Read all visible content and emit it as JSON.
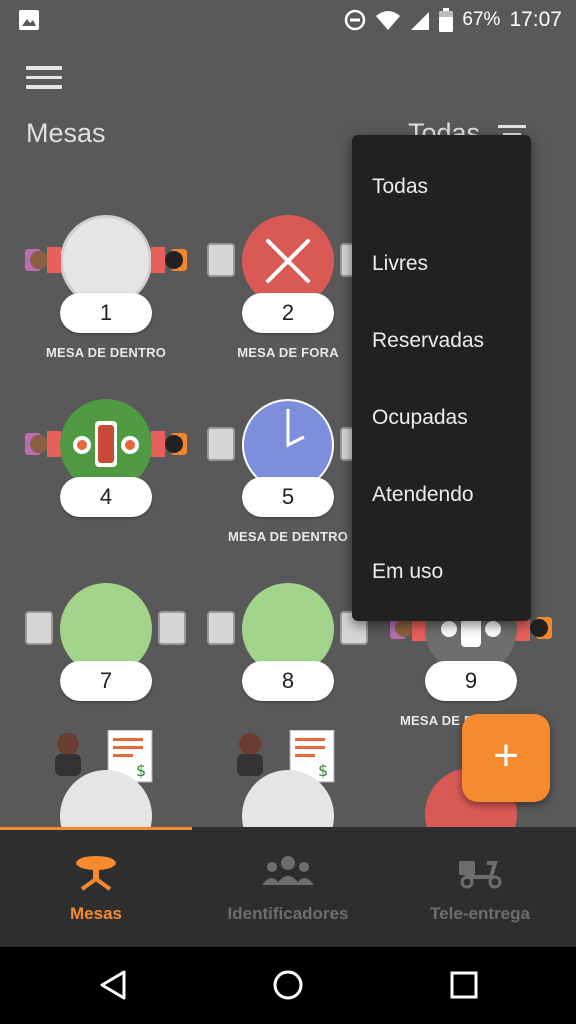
{
  "status_bar": {
    "battery": "67%",
    "time": "17:07"
  },
  "header": {
    "title": "Mesas",
    "filter_label": "Todas"
  },
  "tables": [
    {
      "number": "1",
      "label": "MESA DE DENTRO",
      "state": "occupied"
    },
    {
      "number": "2",
      "label": "MESA DE FORA",
      "state": "reserved"
    },
    {
      "number": "4",
      "label": "",
      "state": "serving"
    },
    {
      "number": "5",
      "label": "MESA DE DENTRO",
      "state": "waiting"
    },
    {
      "number": "7",
      "label": "",
      "state": "free"
    },
    {
      "number": "8",
      "label": "",
      "state": "free"
    },
    {
      "number": "9",
      "label": "MESA DE F",
      "state": "serving"
    }
  ],
  "filter_menu": [
    "Todas",
    "Livres",
    "Reservadas",
    "Ocupadas",
    "Atendendo",
    "Em uso"
  ],
  "fab": {
    "label": "+"
  },
  "bottom_nav": [
    {
      "label": "Mesas",
      "active": true
    },
    {
      "label": "Identificadores",
      "active": false
    },
    {
      "label": "Tele-entrega",
      "active": false
    }
  ],
  "colors": {
    "accent": "#f58a2f",
    "background": "#595959",
    "free": "#a3d48c",
    "reserved": "#d95a55",
    "waiting": "#7d8fdc",
    "serving": "#4f9a42",
    "occupied": "#e5e5e5",
    "menu_bg": "#212121",
    "nav_bg": "#2e2e2e"
  }
}
